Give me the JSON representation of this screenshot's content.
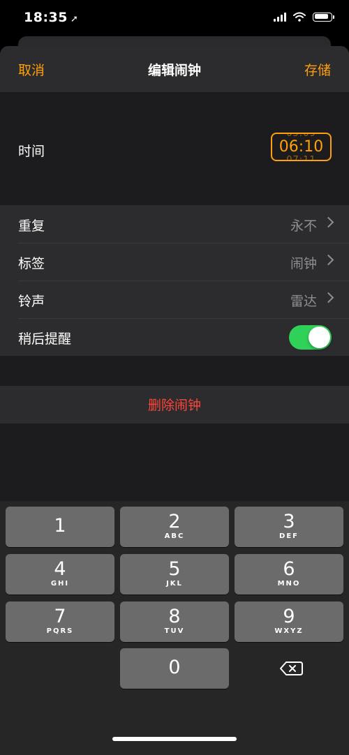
{
  "status_bar": {
    "time": "18:35",
    "location_arrow": "location-arrow-icon",
    "battery_level": 0.85
  },
  "nav": {
    "cancel_label": "取消",
    "title": "编辑闹钟",
    "save_label": "存储"
  },
  "time_section": {
    "label": "时间",
    "value": "06:10",
    "prev_value": "05:09",
    "next_value": "07:11"
  },
  "settings": [
    {
      "label": "重复",
      "value": "永不"
    },
    {
      "label": "标签",
      "value": "闹钟"
    },
    {
      "label": "铃声",
      "value": "雷达"
    }
  ],
  "snooze": {
    "label": "稍后提醒",
    "enabled": true
  },
  "delete_label": "删除闹钟",
  "keypad": [
    {
      "digit": "1",
      "letters": ""
    },
    {
      "digit": "2",
      "letters": "ABC"
    },
    {
      "digit": "3",
      "letters": "DEF"
    },
    {
      "digit": "4",
      "letters": "GHI"
    },
    {
      "digit": "5",
      "letters": "JKL"
    },
    {
      "digit": "6",
      "letters": "MNO"
    },
    {
      "digit": "7",
      "letters": "PQRS"
    },
    {
      "digit": "8",
      "letters": "TUV"
    },
    {
      "digit": "9",
      "letters": "WXYZ"
    },
    {
      "digit": "0",
      "letters": ""
    }
  ],
  "colors": {
    "accent": "#ff9f0a",
    "destructive": "#ff453a",
    "toggle_on": "#30d158"
  }
}
